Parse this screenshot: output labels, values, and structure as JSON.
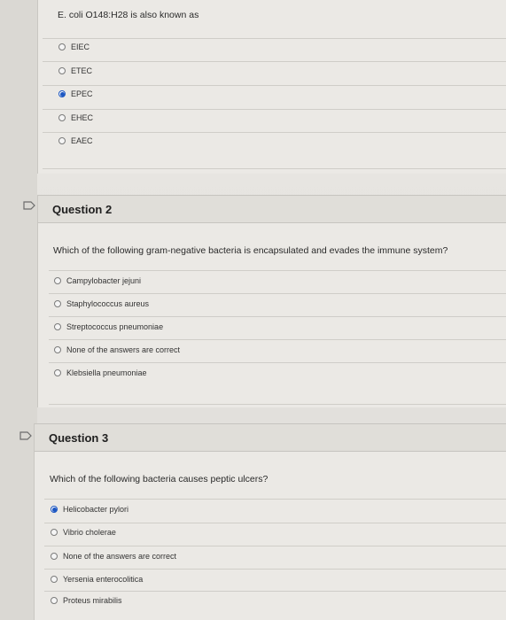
{
  "question1": {
    "text": "E. coli O148:H28 is also known as",
    "options": [
      {
        "label": "EIEC",
        "selected": false
      },
      {
        "label": "ETEC",
        "selected": false
      },
      {
        "label": "EPEC",
        "selected": true
      },
      {
        "label": "EHEC",
        "selected": false
      },
      {
        "label": "EAEC",
        "selected": false
      }
    ]
  },
  "question2": {
    "title": "Question 2",
    "text": "Which of the following gram-negative bacteria is encapsulated and evades the immune system?",
    "options": [
      {
        "label": "Campylobacter jejuni",
        "selected": false
      },
      {
        "label": "Staphylococcus aureus",
        "selected": false
      },
      {
        "label": "Streptococcus pneumoniae",
        "selected": false
      },
      {
        "label": "None of the answers are correct",
        "selected": false
      },
      {
        "label": "Klebsiella pneumoniae",
        "selected": false
      }
    ]
  },
  "question3": {
    "title": "Question 3",
    "text": "Which of the following bacteria causes peptic ulcers?",
    "options": [
      {
        "label": "Helicobacter pylori",
        "selected": true
      },
      {
        "label": "Vibrio cholerae",
        "selected": false
      },
      {
        "label": "None of the answers are correct",
        "selected": false
      },
      {
        "label": "Yersenia enterocolitica",
        "selected": false
      },
      {
        "label": "Proteus mirabilis",
        "selected": false
      }
    ]
  },
  "colors": {
    "selected_radio": "#1c56c2",
    "header_bg": "#e0ded9",
    "page_bg": "#e9e7e3"
  },
  "icons": {
    "flag": "flag-outline-icon"
  }
}
